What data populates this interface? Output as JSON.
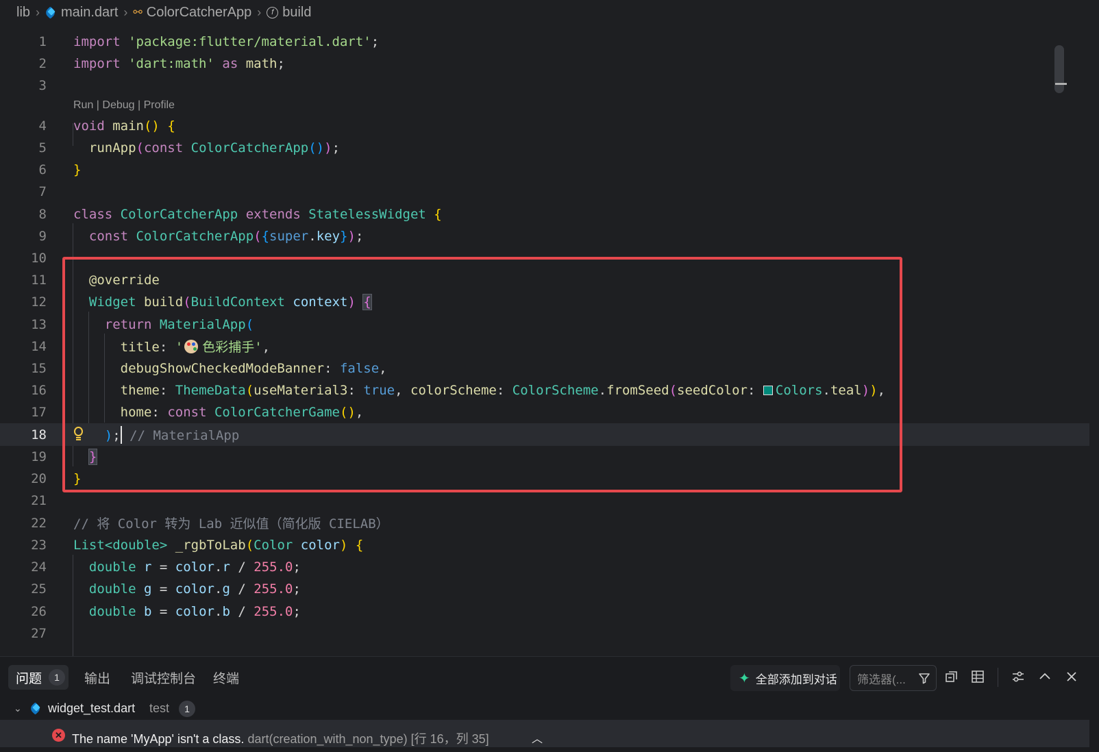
{
  "breadcrumb": {
    "folder": "lib",
    "file": "main.dart",
    "class_name": "ColorCatcherApp",
    "method": "build"
  },
  "editor": {
    "codelens": "Run | Debug | Profile",
    "line_numbers": [
      "1",
      "2",
      "3",
      "4",
      "5",
      "6",
      "7",
      "8",
      "9",
      "10",
      "11",
      "12",
      "13",
      "14",
      "15",
      "16",
      "17",
      "18",
      "19",
      "20",
      "21",
      "22",
      "23",
      "24",
      "25",
      "26",
      "27"
    ],
    "active_line": "18",
    "lines": {
      "l1_kw": "import",
      "l1_str": "'package:flutter/material.dart'",
      "l1_end": ";",
      "l2_kw": "import",
      "l2_str": "'dart:math'",
      "l2_as": "as",
      "l2_name": "math",
      "l2_end": ";",
      "l4_kw": "void",
      "l4_fn": "main",
      "l4_paren": "()",
      "l4_brace": "{",
      "l5_fn": "runApp",
      "l5_open": "(",
      "l5_kw": "const",
      "l5_type": "ColorCatcherApp",
      "l5_inner": "()",
      "l5_close": ")",
      "l5_end": ";",
      "l6_brace": "}",
      "l8_kw": "class",
      "l8_type": "ColorCatcherApp",
      "l8_ext": "extends",
      "l8_base": "StatelessWidget",
      "l8_brace": "{",
      "l9_kw": "const",
      "l9_type": "ColorCatcherApp",
      "l9_open": "(",
      "l9_b": "{",
      "l9_super": "super",
      "l9_dot": ".",
      "l9_key": "key",
      "l9_bc": "}",
      "l9_close": ")",
      "l9_end": ";",
      "l11_ann": "@override",
      "l12_type": "Widget",
      "l12_fn": "build",
      "l12_open": "(",
      "l12_ptype": "BuildContext",
      "l12_param": "context",
      "l12_close": ")",
      "l12_brace": "{",
      "l13_kw": "return",
      "l13_type": "MaterialApp",
      "l13_open": "(",
      "l14_prop": "title",
      "l14_colon": ":",
      "l14_q": "'",
      "l14_text": "色彩捕手'",
      "l14_comma": ",",
      "l15_prop": "debugShowCheckedModeBanner",
      "l15_colon": ":",
      "l15_val": "false",
      "l15_comma": ",",
      "l16_prop": "theme",
      "l16_colon": ":",
      "l16_type": "ThemeData",
      "l16_open": "(",
      "l16_p1": "useMaterial3",
      "l16_c1": ":",
      "l16_v1": "true",
      "l16_sep": ",",
      "l16_p2": "colorScheme",
      "l16_c2": ":",
      "l16_cs": "ColorScheme",
      "l16_dot": ".",
      "l16_fn": "fromSeed",
      "l16_open2": "(",
      "l16_p3": "seedColor",
      "l16_c3": ":",
      "l16_colors": "Colors",
      "l16_dot2": ".",
      "l16_teal": "teal",
      "l16_close2": ")",
      "l16_close": ")",
      "l16_comma": ",",
      "l17_prop": "home",
      "l17_colon": ":",
      "l17_kw": "const",
      "l17_type": "ColorCatcherGame",
      "l17_paren": "()",
      "l17_comma": ",",
      "l18_close": ")",
      "l18_end": ";",
      "l18_cmt": "// MaterialApp",
      "l19_brace": "}",
      "l20_brace": "}",
      "l22_cmt": "// 将 Color 转为 Lab 近似值（简化版 CIELAB）",
      "l23_type": "List",
      "l23_gen": "<double>",
      "l23_fn": "_rgbToLab",
      "l23_open": "(",
      "l23_ptype": "Color",
      "l23_param": "color",
      "l23_close": ")",
      "l23_brace": "{",
      "l24_kw": "double",
      "l24_var": "r",
      "l24_eq": "=",
      "l24_obj": "color",
      "l24_dot": ".",
      "l24_prop": "r",
      "l24_div": "/",
      "l24_num": "255.0",
      "l24_end": ";",
      "l25_kw": "double",
      "l25_var": "g",
      "l25_eq": "=",
      "l25_obj": "color",
      "l25_dot": ".",
      "l25_prop": "g",
      "l25_div": "/",
      "l25_num": "255.0",
      "l25_end": ";",
      "l26_kw": "double",
      "l26_var": "b",
      "l26_eq": "=",
      "l26_obj": "color",
      "l26_dot": ".",
      "l26_prop": "b",
      "l26_div": "/",
      "l26_num": "255.0",
      "l26_end": ";"
    }
  },
  "panel": {
    "tabs": [
      {
        "label": "问题",
        "badge": "1"
      },
      {
        "label": "输出"
      },
      {
        "label": "调试控制台"
      },
      {
        "label": "终端"
      }
    ],
    "add_to_chat_label": "全部添加到对话",
    "filter_placeholder": "筛选器(...",
    "file_group": {
      "name": "widget_test.dart",
      "dir": "test",
      "count": "1"
    },
    "problem": {
      "message": "The name 'MyApp' isn't a class.",
      "source": "dart(creation_with_non_type)",
      "location": "[行 16，列 35]"
    }
  },
  "colors": {
    "background": "#1e1f22",
    "highlight_box": "#e5484d",
    "error": "#e5484d",
    "seed_teal": "#00897b"
  }
}
